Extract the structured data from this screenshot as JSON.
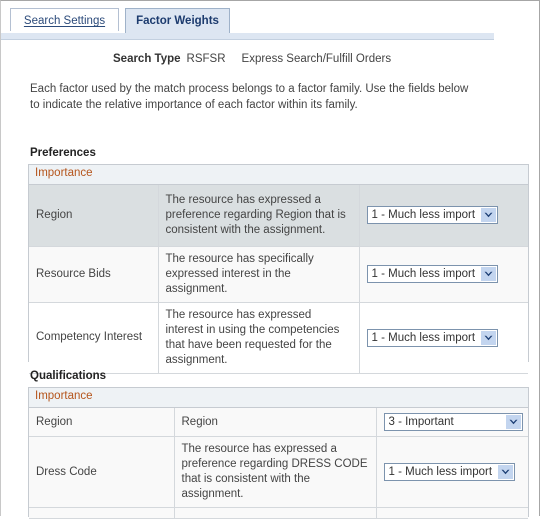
{
  "tabs": [
    {
      "label": "Search Settings",
      "active": false,
      "name": "tab-search-settings"
    },
    {
      "label": "Factor Weights",
      "active": true,
      "name": "tab-factor-weights"
    }
  ],
  "header": {
    "search_type_label": "Search Type",
    "search_type_code": "RSFSR",
    "search_type_name": "Express Search/Fulfill Orders",
    "intro": "Each factor used by the match process belongs to a factor family. Use the fields below to indicate the relative importance of each factor within its family."
  },
  "sections": [
    {
      "title": "Preferences",
      "importance_header": "Importance",
      "rows": [
        {
          "factor": "Region",
          "description": "The resource has expressed a preference regarding Region that is consistent with the assignment.",
          "importance_value": "1 - Much less import"
        },
        {
          "factor": "Resource Bids",
          "description": "The resource has specifically expressed interest in the assignment.",
          "importance_value": "1 - Much less import"
        },
        {
          "factor": "Competency Interest",
          "description": "The resource has expressed interest in using the competencies that have been requested for the assignment.",
          "importance_value": "1 - Much less import"
        }
      ]
    },
    {
      "title": "Qualifications",
      "importance_header": "Importance",
      "rows": [
        {
          "factor": "Region",
          "description": "Region",
          "importance_value": "3 - Important"
        },
        {
          "factor": "Dress Code",
          "description": "The resource has expressed a preference regarding DRESS CODE that is consistent with the assignment.",
          "importance_value": "1 - Much less import"
        }
      ]
    }
  ],
  "colors": {
    "importance_header_text": "#b5551c",
    "active_tab_bg": "#dde6f2",
    "active_tab_text": "#1c3b6e",
    "inactive_tab_text": "#2b4a7a",
    "row_highlight_bg": "#dadfe1",
    "select_border": "#7c93ad",
    "select_arrow_bg": "#c3d5ef"
  },
  "icons": {
    "dropdown_arrow": "chevron-down-icon"
  }
}
